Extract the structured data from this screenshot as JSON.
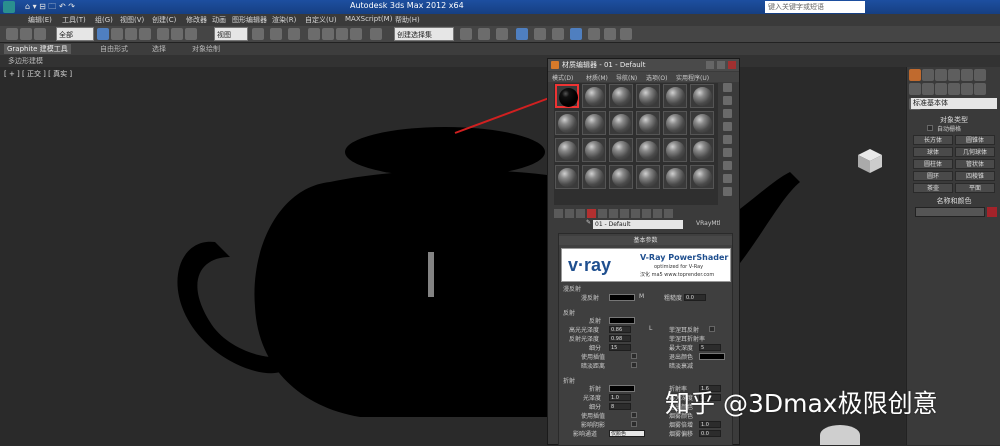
{
  "titlebar": {
    "title": "Autodesk 3ds Max  2012 x64",
    "search_placeholder": "键入关键字或短语",
    "quick_access": "⌂ ▾ ⊟ 🗀 ↶ ↷"
  },
  "menubar": {
    "items": [
      "编辑(E)",
      "工具(T)",
      "组(G)",
      "视图(V)",
      "创建(C)",
      "修改器",
      "动画",
      "图形编辑器",
      "渲染(R)",
      "自定义(U)",
      "MAXScript(M)",
      "帮助(H)"
    ]
  },
  "toolbar": {
    "selection_filter": "全部",
    "ref_coord": "视图",
    "named_selection": "创建选择集"
  },
  "ribbon": {
    "tabs": [
      "Graphite 建模工具",
      "自由形式",
      "选择",
      "对象绘制"
    ],
    "sub_label": "多边形建模"
  },
  "viewport": {
    "label": "[ + ] [ 正交 ] [ 真实 ]"
  },
  "right_panel": {
    "category_select": "标准基本体",
    "object_type_header": "对象类型",
    "autogrid": "自动栅格",
    "buttons": [
      "长方体",
      "圆锥体",
      "球体",
      "几何球体",
      "圆柱体",
      "管状体",
      "圆环",
      "四棱锥",
      "茶壶",
      "平面"
    ],
    "name_color_header": "名称和颜色",
    "object_color": "#a3232a"
  },
  "material_editor": {
    "title": "材质编辑器 - 01 - Default",
    "menu": [
      "模式(D)",
      "材质(M)",
      "导航(N)",
      "选项(O)",
      "实用程序(U)"
    ],
    "material_name": "01 - Default",
    "material_type": "VRayMtl",
    "basic_params_header": "基本参数",
    "banner": {
      "logo": "v·ray",
      "product": "V-Ray PowerShader",
      "optimized": "optimized for V-Ray",
      "credit": "汉化 ma5 www.toprender.com"
    },
    "diffuse_section": "漫反射",
    "diffuse_label": "漫反射",
    "diffuse_map_button": "M",
    "roughness_label": "粗糙度",
    "roughness_value": "0.0",
    "reflection_section": "反射",
    "reflect_label": "反射",
    "hilight_gloss_label": "高光光泽度",
    "hilight_gloss_value": "0.86",
    "hilight_lock": "L",
    "refl_gloss_label": "反射光泽度",
    "refl_gloss_value": "0.98",
    "subdivs_label": "细分",
    "subdivs_value": "15",
    "use_interp_label": "使用插值",
    "dim_distance_label": "暗淡距离",
    "fresnel_label": "菲涅耳反射",
    "fresnel_ior_label": "菲涅耳折射率",
    "max_depth_label": "最大深度",
    "max_depth_value": "5",
    "exit_color_label": "退出颜色",
    "dim_falloff_label": "暗淡衰减",
    "refraction_section": "折射",
    "refract_label": "折射",
    "refr_gloss_label": "光泽度",
    "refr_gloss_value": "1.0",
    "refr_subdivs_label": "细分",
    "refr_subdivs_value": "8",
    "refr_use_interp_label": "使用插值",
    "affect_shadows_label": "影响阴影",
    "affect_channels_label": "影响通道",
    "affect_channels_value": "仅颜色",
    "ior_label": "折射率",
    "ior_value": "1.6",
    "max_depth2_label": "最大深度",
    "max_depth2_value": "5",
    "exit_color2_label": "退出颜色",
    "fog_color_label": "烟雾颜色",
    "fog_multiplier_label": "烟雾倍增",
    "fog_multiplier_value": "1.0",
    "fog_bias_label": "烟雾偏移",
    "fog_bias_value": "0.0"
  },
  "watermark": "知乎 @3Dmax极限创意"
}
